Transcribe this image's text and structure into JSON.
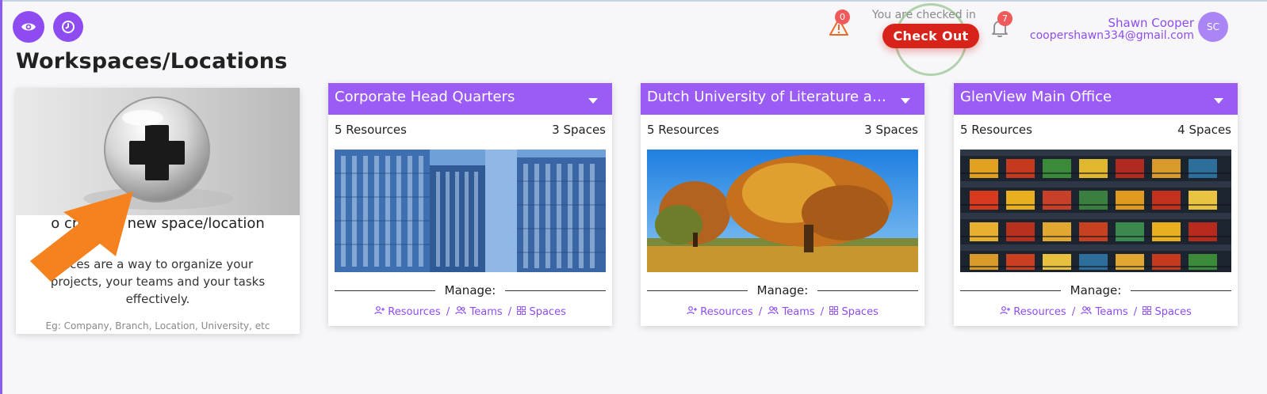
{
  "page": {
    "title": "Workspaces/Locations"
  },
  "header": {
    "alerts_count": "0",
    "notifications_count": "7",
    "checked_in_text": "You are checked in",
    "checkout_label": "Check Out",
    "user": {
      "name": "Shawn Cooper",
      "email": "coopershawn334@gmail.com",
      "initials": "SC"
    }
  },
  "create_card": {
    "heading": "o create a new space/location",
    "description": "aces are a way to organize your projects, your teams and your tasks effectively.",
    "example": "Eg: Company, Branch, Location, University, etc"
  },
  "workspaces": [
    {
      "name": "Corporate Head Quarters",
      "resources": "5 Resources",
      "spaces": "3 Spaces"
    },
    {
      "name": "Dutch University of Literature and…",
      "resources": "5 Resources",
      "spaces": "3 Spaces"
    },
    {
      "name": "GlenView Main Office",
      "resources": "5 Resources",
      "spaces": "4 Spaces"
    }
  ],
  "manage": {
    "label": "Manage:",
    "resources_label": "Resources",
    "teams_label": "Teams",
    "spaces_label": "Spaces",
    "separator": "/"
  },
  "colors": {
    "accent": "#9b5cf6",
    "checkout": "#d8231a",
    "badge": "#f05a5a"
  },
  "icons": [
    "eye-icon",
    "clock-icon",
    "warning-icon",
    "bell-icon",
    "plus-icon",
    "user-plus-icon",
    "users-icon",
    "grid-icon",
    "chevron-down-icon"
  ]
}
